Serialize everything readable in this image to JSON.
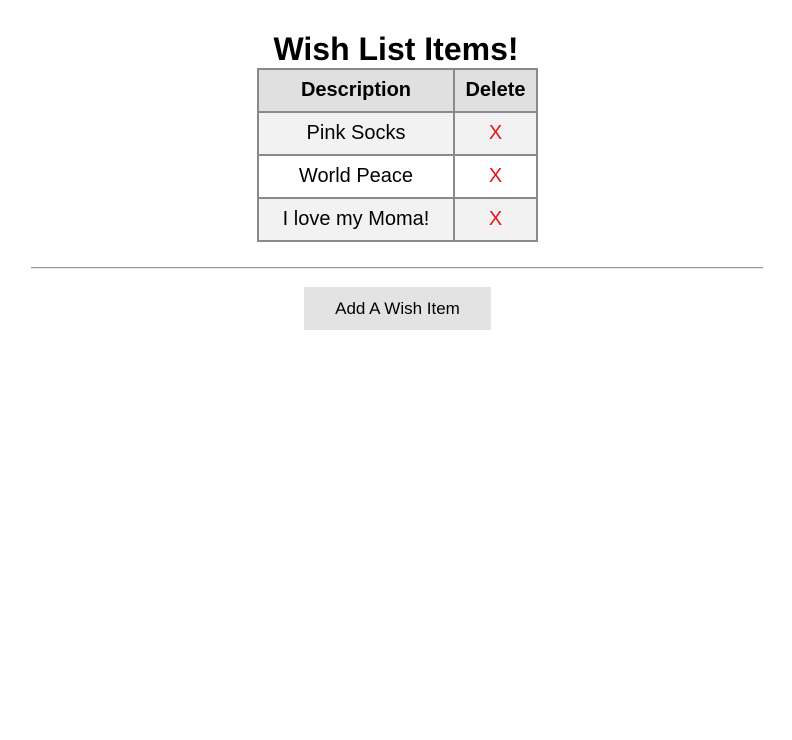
{
  "page": {
    "title": "Wish List Items!"
  },
  "table": {
    "headers": {
      "description": "Description",
      "delete": "Delete"
    },
    "rows": [
      {
        "description": "Pink Socks",
        "delete": "X"
      },
      {
        "description": "World Peace",
        "delete": "X"
      },
      {
        "description": "I love my Moma!",
        "delete": "X"
      }
    ]
  },
  "actions": {
    "add_label": "Add A Wish Item"
  },
  "colors": {
    "delete_x": "#e8141e",
    "header_bg": "#e0e0e0",
    "odd_row_bg": "#f2f2f2",
    "button_bg": "#e3e3e3"
  }
}
